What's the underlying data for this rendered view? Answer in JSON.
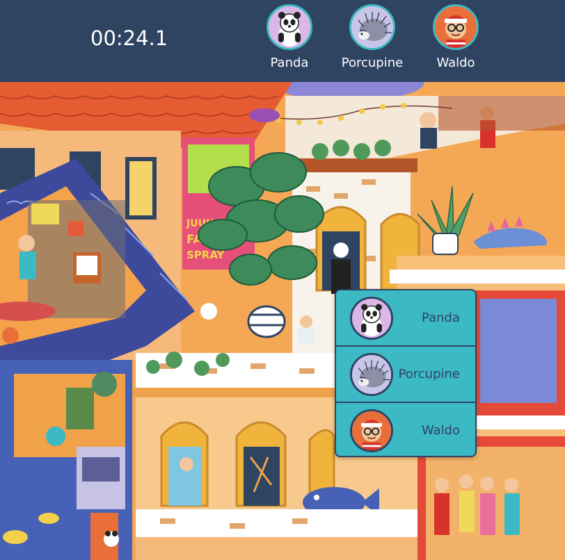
{
  "header": {
    "timer": "00:24.1",
    "targets": [
      {
        "name": "Panda",
        "icon": "panda-icon"
      },
      {
        "name": "Porcupine",
        "icon": "porcupine-icon"
      },
      {
        "name": "Waldo",
        "icon": "waldo-icon"
      }
    ]
  },
  "popup": {
    "options": [
      {
        "name": "Panda",
        "icon": "panda-icon"
      },
      {
        "name": "Porcupine",
        "icon": "porcupine-icon"
      },
      {
        "name": "Waldo",
        "icon": "waldo-icon"
      }
    ]
  },
  "scene": {
    "sign_text_1": "JUUU",
    "sign_text_2": "FARI",
    "sign_text_3": "SPRAY"
  },
  "colors": {
    "header_bg": "#2e4461",
    "accent": "#3bb9c5",
    "text_light": "#ffffff",
    "text_dark": "#2e4461"
  }
}
